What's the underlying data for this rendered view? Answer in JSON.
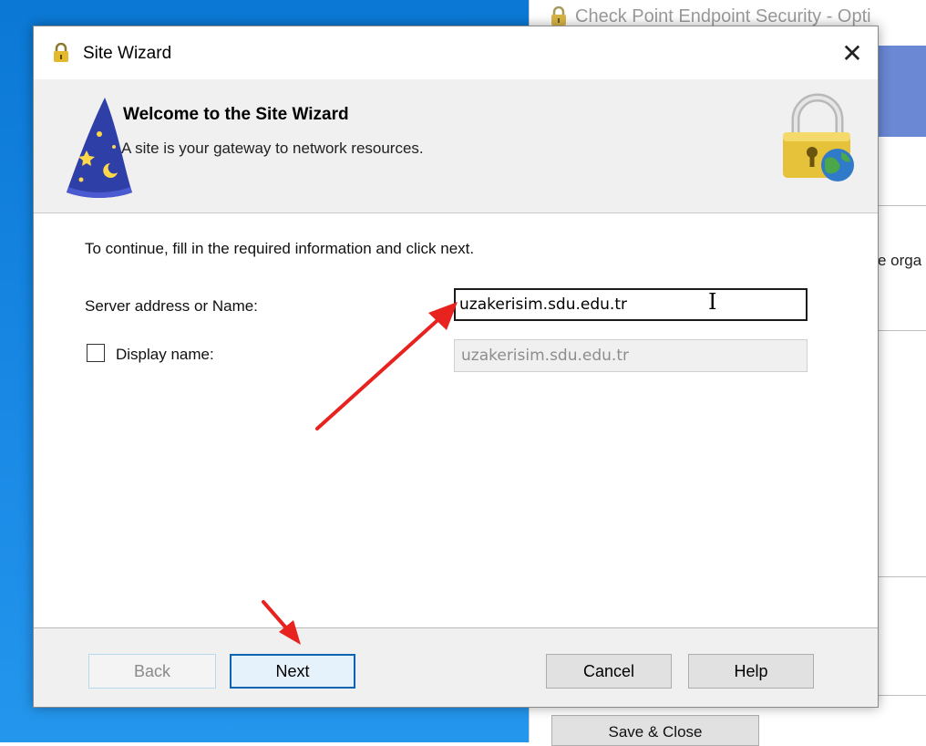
{
  "background_window": {
    "title": "Check Point Endpoint Security - Opti",
    "partial_text": "e orga",
    "save_close_label": "Save & Close"
  },
  "dialog": {
    "title": "Site Wizard",
    "close_label": "✕",
    "header": {
      "title": "Welcome to the Site Wizard",
      "subtitle": "A site is your gateway to network resources."
    },
    "instruction": "To continue, fill in the required information and click next.",
    "server": {
      "label": "Server address or Name:",
      "value": "uzakerisim.sdu.edu.tr"
    },
    "display_name": {
      "label": "Display name:",
      "checked": false,
      "value": "uzakerisim.sdu.edu.tr"
    },
    "buttons": {
      "back": "Back",
      "next": "Next",
      "cancel": "Cancel",
      "help": "Help"
    }
  },
  "colors": {
    "annotation_arrow": "#e8221f",
    "desktop": "#0a78d4",
    "next_border": "#0a64b4"
  },
  "icons": {
    "title": "padlock-icon",
    "wizard": "wizard-hat-icon",
    "header": "padlock-globe-icon"
  }
}
